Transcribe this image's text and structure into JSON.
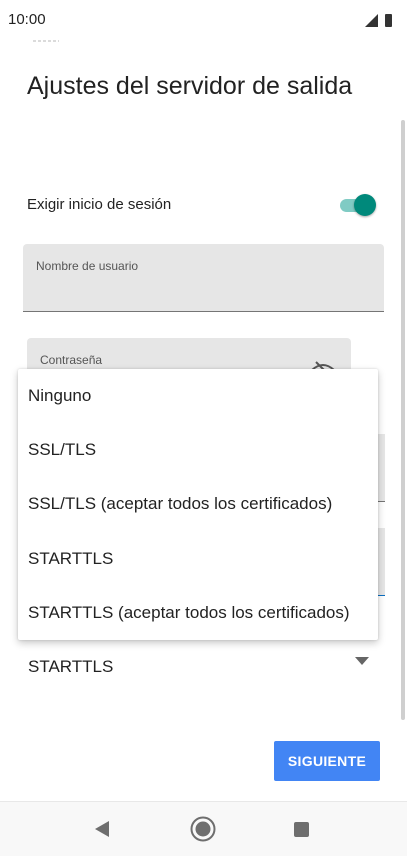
{
  "status_bar": {
    "time": "10:00",
    "icons": [
      "signal-icon",
      "battery-icon"
    ]
  },
  "page": {
    "title": "Ajustes del servidor de salida"
  },
  "login_toggle": {
    "label": "Exigir inicio de sesión",
    "on": true,
    "track_color": "#80cbc4",
    "thumb_color": "#00897b"
  },
  "fields": {
    "username_label": "Nombre de usuario",
    "username_value": "",
    "password_label": "Contraseña"
  },
  "security": {
    "selected": "STARTTLS",
    "options": [
      "Ninguno",
      "SSL/TLS",
      "SSL/TLS (aceptar todos los certificados)",
      "STARTTLS",
      "STARTTLS (aceptar todos los certificados)"
    ]
  },
  "actions": {
    "next_label": "SIGUIENTE",
    "next_color": "#4285f4"
  },
  "nav_bar": {
    "icons": [
      "back-icon",
      "home-icon",
      "recents-icon"
    ]
  }
}
